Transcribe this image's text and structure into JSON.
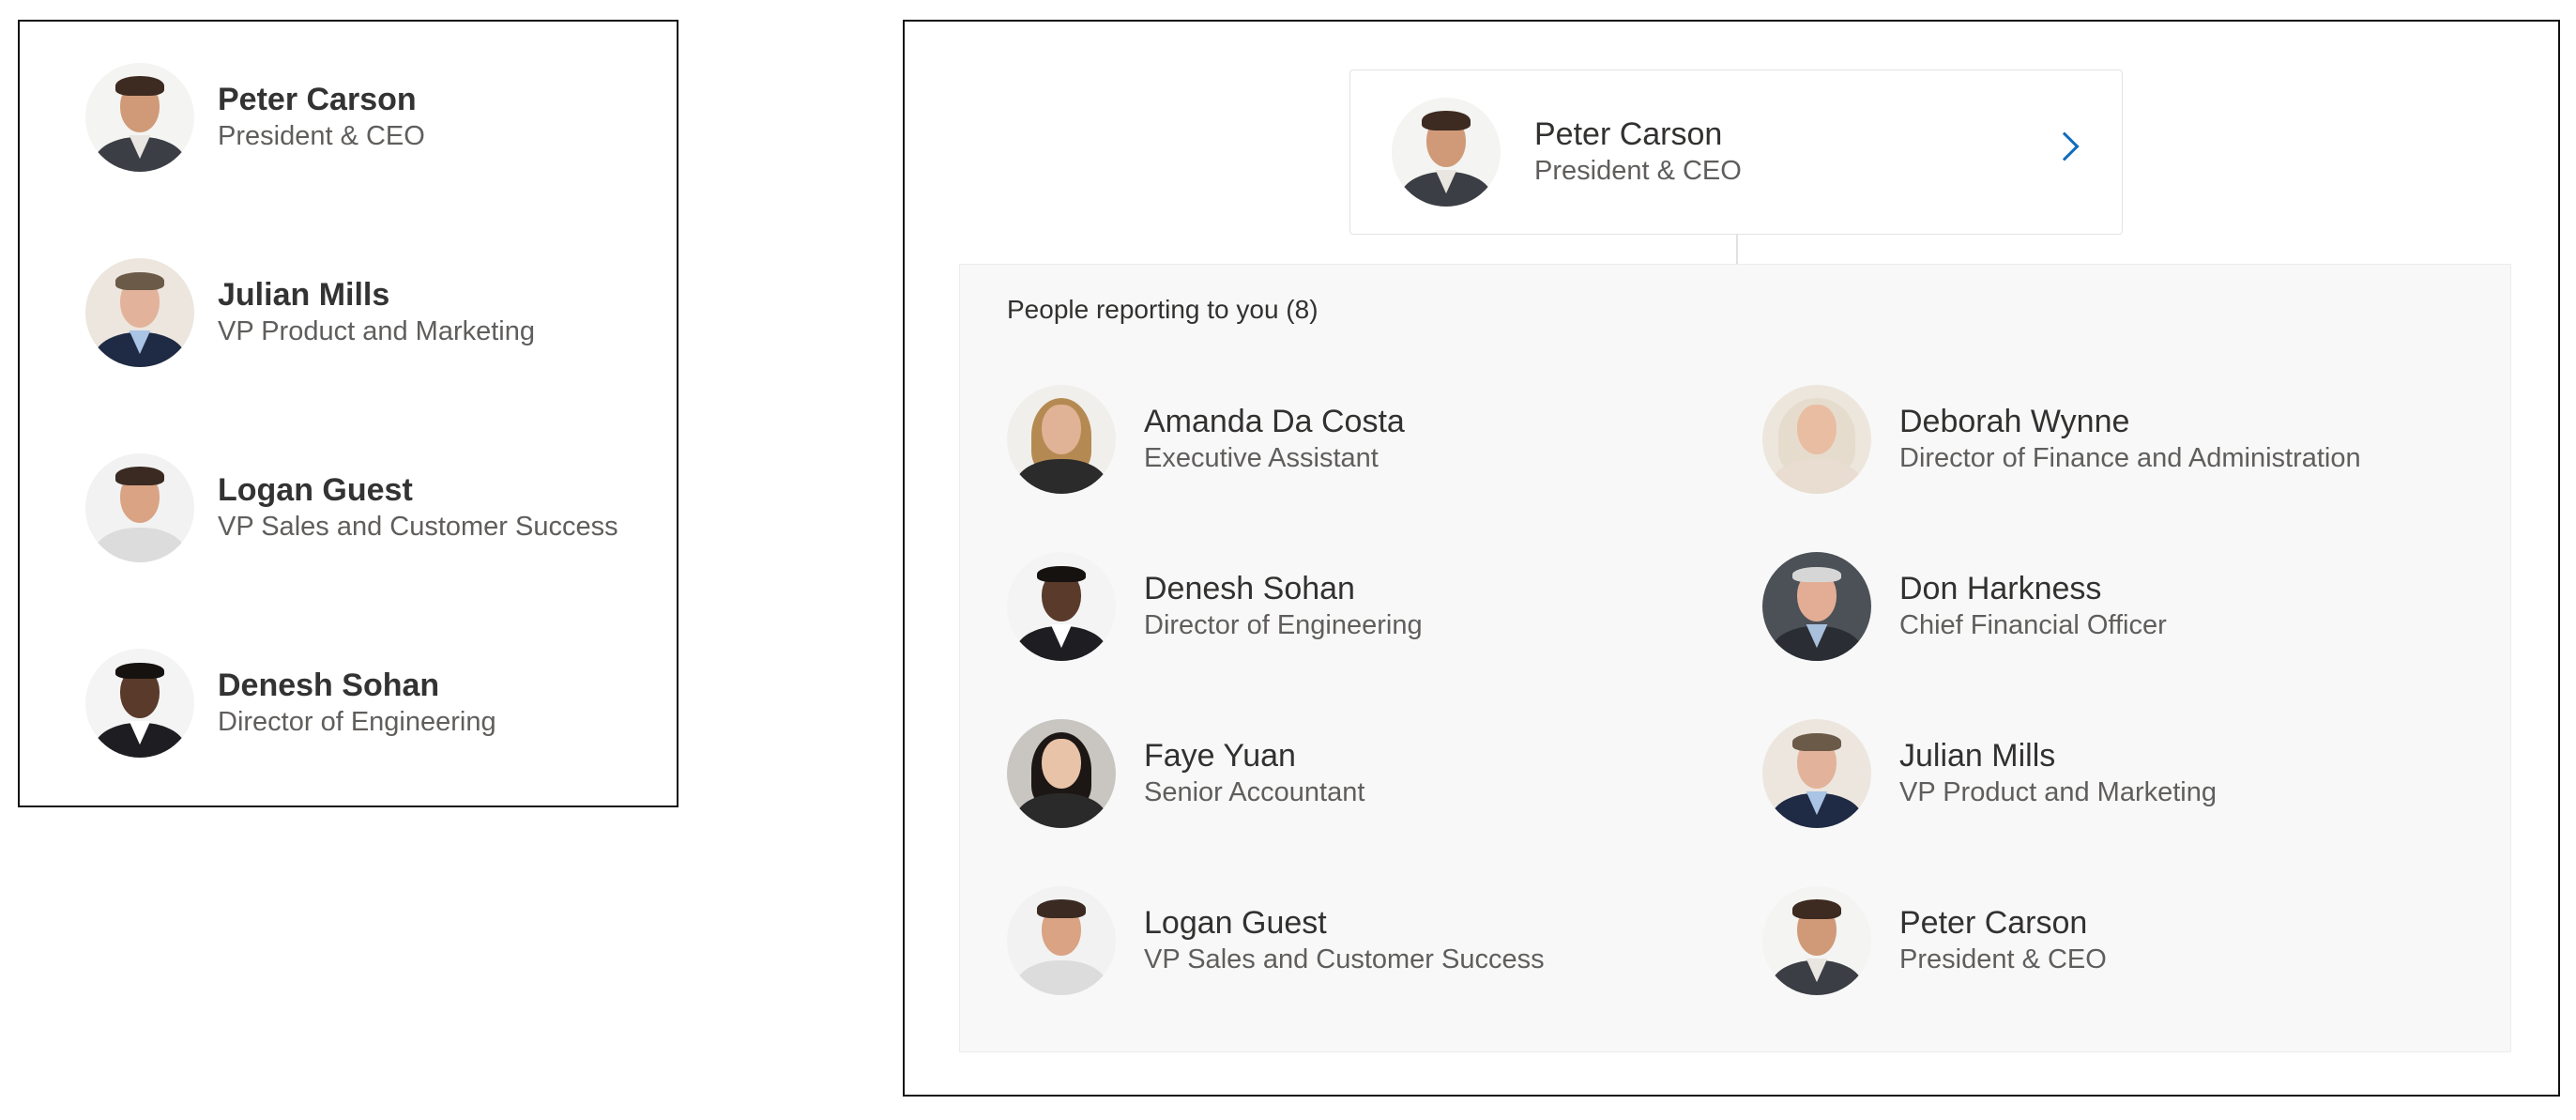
{
  "left_list": {
    "people": [
      {
        "name": "Peter Carson",
        "title": "President & CEO"
      },
      {
        "name": "Julian Mills",
        "title": "VP Product and Marketing"
      },
      {
        "name": "Logan Guest",
        "title": "VP Sales and Customer Success"
      },
      {
        "name": "Denesh Sohan",
        "title": "Director of Engineering"
      }
    ]
  },
  "org_chart": {
    "manager": {
      "name": "Peter Carson",
      "title": "President & CEO"
    },
    "reports_heading": "People reporting to you (8)",
    "reports": [
      {
        "name": "Amanda Da Costa",
        "title": "Executive Assistant"
      },
      {
        "name": "Deborah Wynne",
        "title": "Director of Finance and Administration"
      },
      {
        "name": "Denesh Sohan",
        "title": "Director of Engineering"
      },
      {
        "name": "Don Harkness",
        "title": "Chief Financial Officer"
      },
      {
        "name": "Faye Yuan",
        "title": "Senior Accountant"
      },
      {
        "name": "Julian Mills",
        "title": "VP Product and Marketing"
      },
      {
        "name": "Logan Guest",
        "title": "VP Sales and Customer Success"
      },
      {
        "name": "Peter Carson",
        "title": "President & CEO"
      }
    ]
  },
  "colors": {
    "accent": "#0f6cbd",
    "panel_border": "#111111",
    "reports_background": "#f8f8f8"
  }
}
